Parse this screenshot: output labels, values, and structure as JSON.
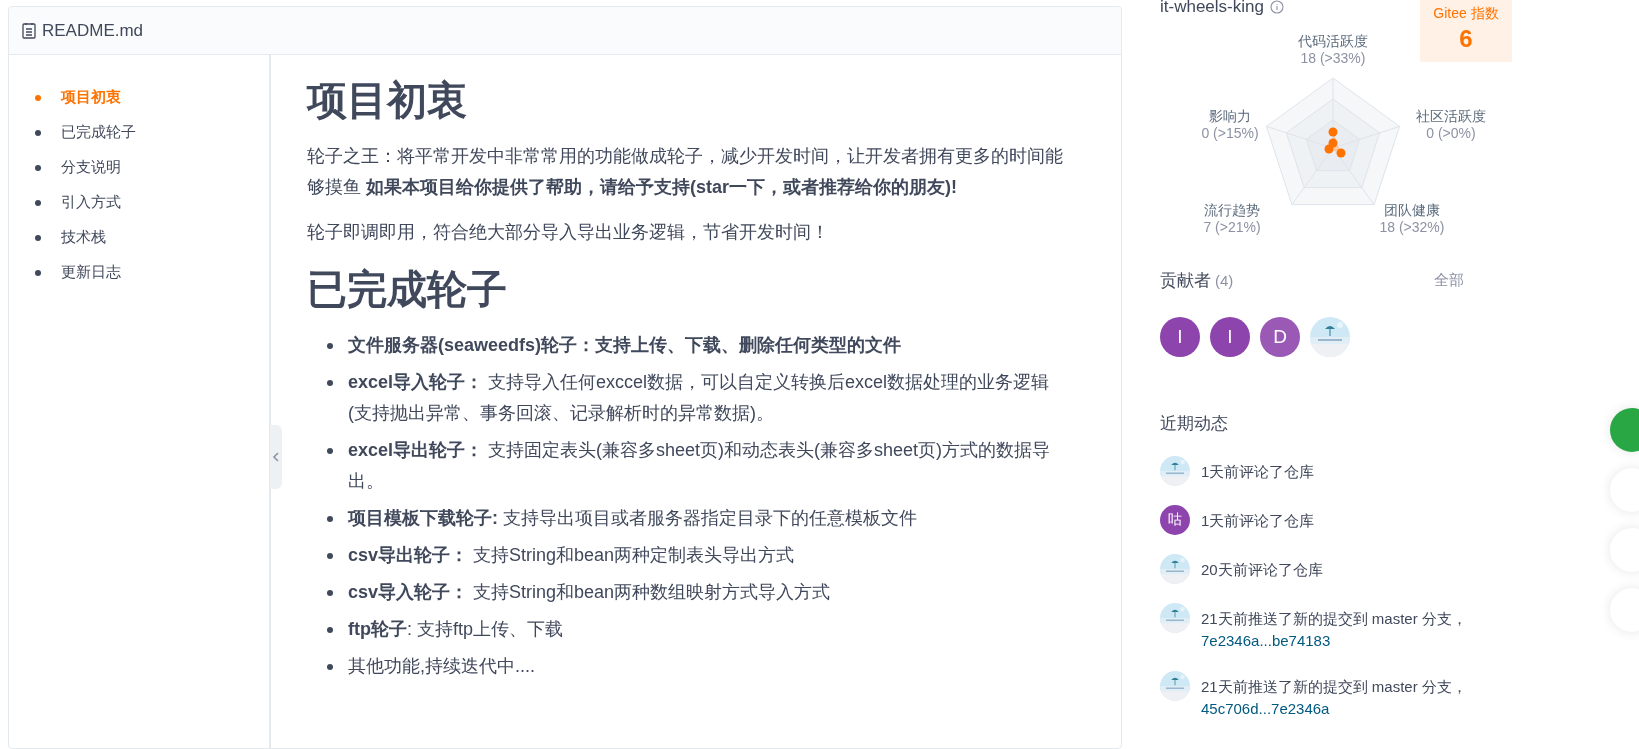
{
  "readme": {
    "file_name": "README.md",
    "toc": [
      {
        "label": "项目初衷",
        "selected": true
      },
      {
        "label": "已完成轮子",
        "selected": false
      },
      {
        "label": "分支说明",
        "selected": false
      },
      {
        "label": "引入方式",
        "selected": false
      },
      {
        "label": "技术栈",
        "selected": false
      },
      {
        "label": "更新日志",
        "selected": false
      }
    ],
    "sections": [
      {
        "heading": "项目初衷",
        "paragraphs": [
          "轮子之王：将平常开发中非常常用的功能做成轮子，减少开发时间，让开发者拥有更多的时间能够摸鱼 **如果本项目给你提供了帮助，请给予支持(star一下，或者推荐给你的朋友)!**",
          "轮子即调即用，符合绝大部分导入导出业务逻辑，节省开发时间！"
        ]
      },
      {
        "heading": "已完成轮子",
        "items": [
          "**文件服务器(seaweedfs)轮子：支持上传、下载、删除任何类型的文件**",
          "**excel导入轮子：** 支持导入任何exccel数据，可以自定义转换后excel数据处理的业务逻辑(支持抛出异常、事务回滚、记录解析时的异常数据)。",
          "**excel导出轮子：** 支持固定表头(兼容多sheet页)和动态表头(兼容多sheet页)方式的数据导出。",
          "**项目模板下载轮子:** 支持导出项目或者服务器指定目录下的任意模板文件",
          "**csv导出轮子：** 支持String和bean两种定制表头导出方式",
          "**csv导入轮子：** 支持String和bean两种数组映射方式导入方式",
          "**ftp轮子**: 支持ftp上传、下载",
          "其他功能,持续迭代中...."
        ]
      }
    ]
  },
  "sidebar": {
    "repo_name": "it-wheels-king",
    "gitee_index": {
      "label": "Gitee 指数",
      "value": "6"
    },
    "radar_axes": [
      {
        "label": "代码活跃度",
        "reading": "18 (>33%)"
      },
      {
        "label": "影响力",
        "reading": "0 (>15%)"
      },
      {
        "label": "社区活跃度",
        "reading": "0 (>0%)"
      },
      {
        "label": "流行趋势",
        "reading": "7 (>21%)"
      },
      {
        "label": "团队健康",
        "reading": "18 (>32%)"
      }
    ],
    "contributors": {
      "title": "贡献者",
      "count": "(4)",
      "all_link": "全部",
      "avatars": [
        {
          "kind": "letter",
          "letter": "I",
          "color": "#8e44ad"
        },
        {
          "kind": "letter",
          "letter": "I",
          "color": "#8e44ad"
        },
        {
          "kind": "letter",
          "letter": "D",
          "color": "#9b59b6"
        },
        {
          "kind": "picture"
        }
      ]
    },
    "activity": {
      "title": "近期动态",
      "items": [
        {
          "avatar": {
            "kind": "picture"
          },
          "text": "1天前评论了仓库"
        },
        {
          "avatar": {
            "kind": "letter",
            "letter": "咕",
            "color": "#8e44ad"
          },
          "text": "1天前评论了仓库"
        },
        {
          "avatar": {
            "kind": "picture"
          },
          "text": "20天前评论了仓库"
        },
        {
          "avatar": {
            "kind": "picture"
          },
          "text": "21天前推送了新的提交到 master 分支，",
          "link": "7e2346a...be74183"
        },
        {
          "avatar": {
            "kind": "picture"
          },
          "text": "21天前推送了新的提交到 master 分支，",
          "link": "45c706d...7e2346a"
        }
      ]
    }
  }
}
